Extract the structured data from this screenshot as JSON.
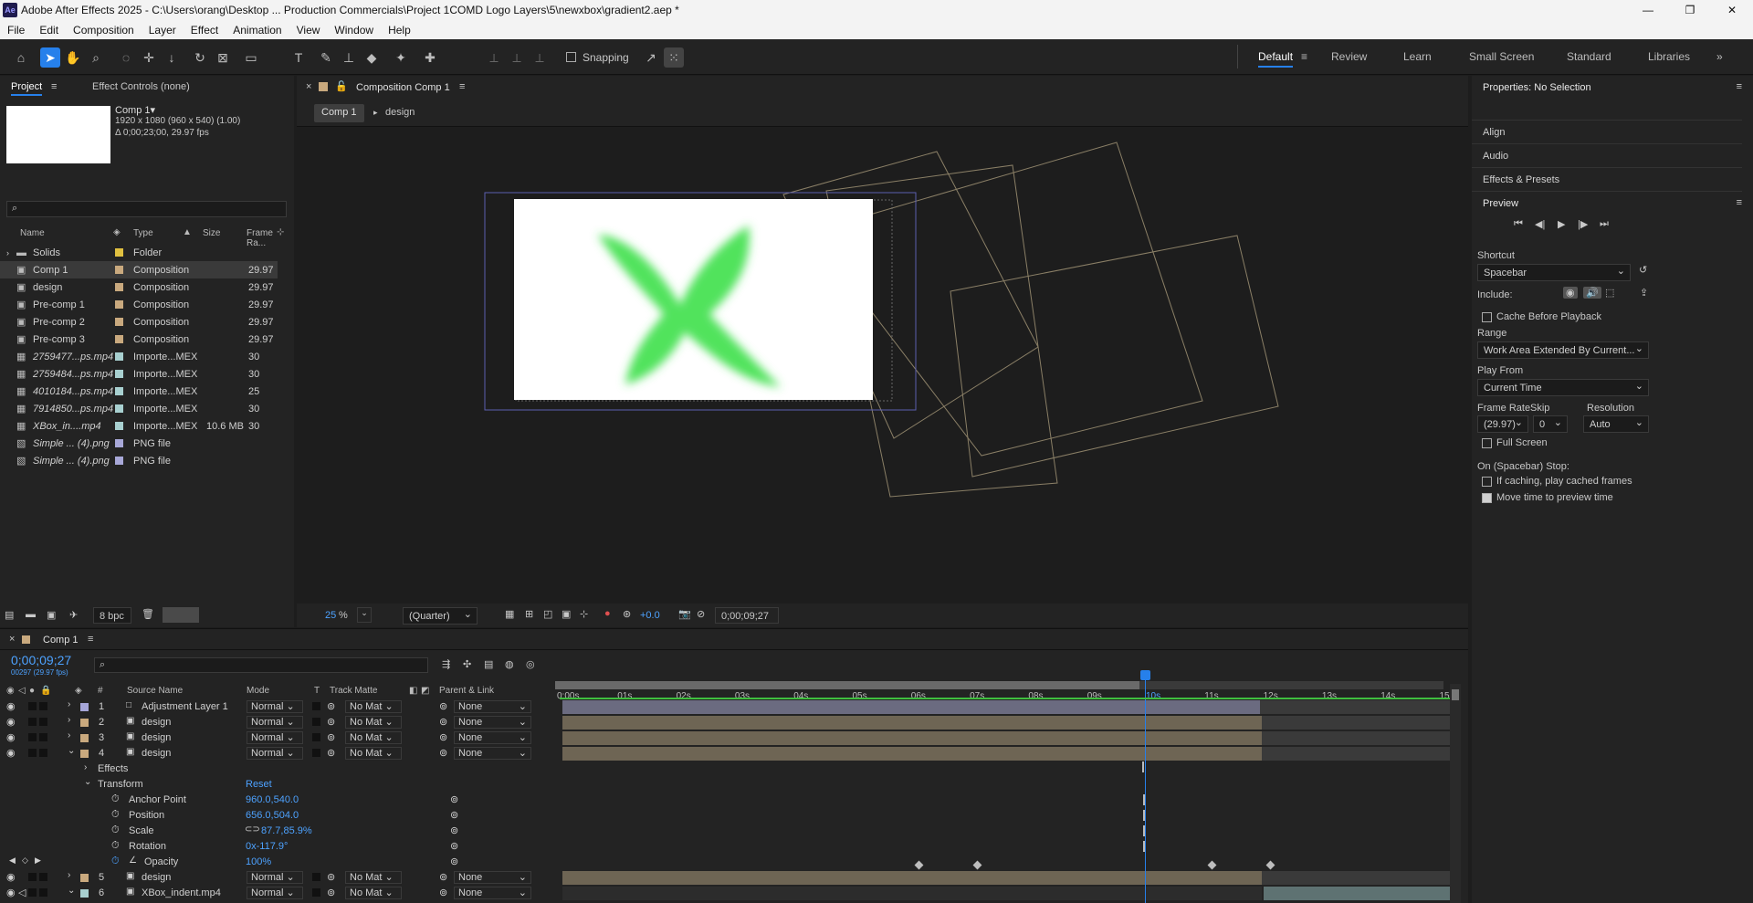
{
  "titlebar": {
    "app_icon": "Ae",
    "title": "Adobe After Effects 2025 - C:\\Users\\orang\\Desktop ... Production Commercials\\Project 1COMD Logo Layers\\5\\newxbox\\gradient2.aep *",
    "minimize": "—",
    "maximize": "❐",
    "close": "✕"
  },
  "menu": [
    "File",
    "Edit",
    "Composition",
    "Layer",
    "Effect",
    "Animation",
    "View",
    "Window",
    "Help"
  ],
  "toolbar": {
    "snapping_label": "Snapping",
    "workspaces": [
      "Default",
      "Review",
      "Learn",
      "Small Screen",
      "Standard",
      "Libraries"
    ],
    "more": "»"
  },
  "project": {
    "tab_project": "Project",
    "tab_effect_controls": "Effect Controls (none)",
    "comp_name": "Comp 1▾",
    "comp_info_1": "1920 x 1080  (960 x 540) (1.00)",
    "comp_info_2": "Δ 0;00;23;00, 29.97 fps",
    "search_placeholder": "",
    "columns": [
      "Name",
      "Type",
      "Size",
      "Frame Ra..."
    ],
    "items": [
      {
        "name": "Solids",
        "type": "Folder",
        "size": "",
        "fps": "",
        "color": "#e0c040",
        "icon": "folder"
      },
      {
        "name": "Comp 1",
        "type": "Composition",
        "size": "",
        "fps": "29.97",
        "color": "#c9a97e",
        "icon": "comp",
        "selected": true
      },
      {
        "name": "design",
        "type": "Composition",
        "size": "",
        "fps": "29.97",
        "color": "#c9a97e",
        "icon": "comp"
      },
      {
        "name": "Pre-comp 1",
        "type": "Composition",
        "size": "",
        "fps": "29.97",
        "color": "#c9a97e",
        "icon": "comp"
      },
      {
        "name": "Pre-comp 2",
        "type": "Composition",
        "size": "",
        "fps": "29.97",
        "color": "#c9a97e",
        "icon": "comp"
      },
      {
        "name": "Pre-comp 3",
        "type": "Composition",
        "size": "",
        "fps": "29.97",
        "color": "#c9a97e",
        "icon": "comp"
      },
      {
        "name": "2759477...ps.mp4",
        "type": "Importe...MEX",
        "size": "",
        "fps": "30",
        "color": "#a8d0d0",
        "icon": "video"
      },
      {
        "name": "2759484...ps.mp4",
        "type": "Importe...MEX",
        "size": "",
        "fps": "30",
        "color": "#a8d0d0",
        "icon": "video"
      },
      {
        "name": "4010184...ps.mp4",
        "type": "Importe...MEX",
        "size": "",
        "fps": "25",
        "color": "#a8d0d0",
        "icon": "video"
      },
      {
        "name": "7914850...ps.mp4",
        "type": "Importe...MEX",
        "size": "",
        "fps": "30",
        "color": "#a8d0d0",
        "icon": "video"
      },
      {
        "name": "XBox_in....mp4",
        "type": "Importe...MEX",
        "size": "10.6 MB",
        "fps": "30",
        "color": "#a8d0d0",
        "icon": "video"
      },
      {
        "name": "Simple ... (4).png",
        "type": "PNG file",
        "size": "",
        "fps": "",
        "color": "#a8a8d8",
        "icon": "image"
      },
      {
        "name": "Simple ... (4).png",
        "type": "PNG file",
        "size": "",
        "fps": "",
        "color": "#a8a8d8",
        "icon": "image"
      }
    ],
    "bpc": "8 bpc"
  },
  "composition": {
    "tab_label": "Composition Comp 1",
    "breadcrumbs": [
      "Comp 1",
      "design"
    ],
    "zoom": "25",
    "zoom_unit": "%",
    "quality": "(Quarter)",
    "exposure": "+0.0",
    "timecode": "0;00;09;27"
  },
  "properties": {
    "title": "Properties: No Selection",
    "sections": [
      "Align",
      "Audio",
      "Effects & Presets"
    ],
    "preview": {
      "title": "Preview",
      "shortcut_label": "Shortcut",
      "shortcut_value": "Spacebar",
      "include_label": "Include:",
      "cache_before": "Cache Before Playback",
      "range_label": "Range",
      "range_value": "Work Area Extended By Current...",
      "play_from_label": "Play From",
      "play_from_value": "Current Time",
      "frame_rate_label": "Frame Rate",
      "skip_label": "Skip",
      "resolution_label": "Resolution",
      "frame_rate_value": "(29.97)",
      "skip_value": "0",
      "resolution_value": "Auto",
      "full_screen": "Full Screen",
      "on_stop_label": "On (Spacebar) Stop:",
      "if_caching": "If caching, play cached frames",
      "move_time": "Move time to preview time"
    }
  },
  "timeline": {
    "tab": "Comp 1",
    "timecode": "0;00;09;27",
    "sub_timecode": "00297 (29.97 fps)",
    "columns": {
      "num": "#",
      "source": "Source Name",
      "mode": "Mode",
      "t": "T",
      "track_matte": "Track Matte",
      "parent": "Parent & Link"
    },
    "ruler": [
      "0:00s",
      "01s",
      "02s",
      "03s",
      "04s",
      "05s",
      "06s",
      "07s",
      "08s",
      "09s",
      "10s",
      "11s",
      "12s",
      "13s",
      "14s",
      "15s"
    ],
    "layers": [
      {
        "num": "1",
        "name": "Adjustment Layer 1",
        "mode": "Normal",
        "matte": "No Mat",
        "parent": "None",
        "color": "#a5a5d8"
      },
      {
        "num": "2",
        "name": "design",
        "mode": "Normal",
        "matte": "No Mat",
        "parent": "None",
        "color": "#c9a97e"
      },
      {
        "num": "3",
        "name": "design",
        "mode": "Normal",
        "matte": "No Mat",
        "parent": "None",
        "color": "#c9a97e"
      },
      {
        "num": "4",
        "name": "design",
        "mode": "Normal",
        "matte": "No Mat",
        "parent": "None",
        "color": "#c9a97e"
      },
      {
        "num": "5",
        "name": "design",
        "mode": "Normal",
        "matte": "No Mat",
        "parent": "None",
        "color": "#c9a97e"
      },
      {
        "num": "6",
        "name": "XBox_indent.mp4",
        "mode": "Normal",
        "matte": "No Mat",
        "parent": "None",
        "color": "#a8d0d0"
      }
    ],
    "effects_label": "Effects",
    "transform_label": "Transform",
    "reset_label": "Reset",
    "props": [
      {
        "name": "Anchor Point",
        "value": "960.0,540.0"
      },
      {
        "name": "Position",
        "value": "656.0,504.0"
      },
      {
        "name": "Scale",
        "value": "87.7,85.9%"
      },
      {
        "name": "Rotation",
        "value": "0x-117.9°"
      },
      {
        "name": "Opacity",
        "value": "100%"
      }
    ]
  }
}
